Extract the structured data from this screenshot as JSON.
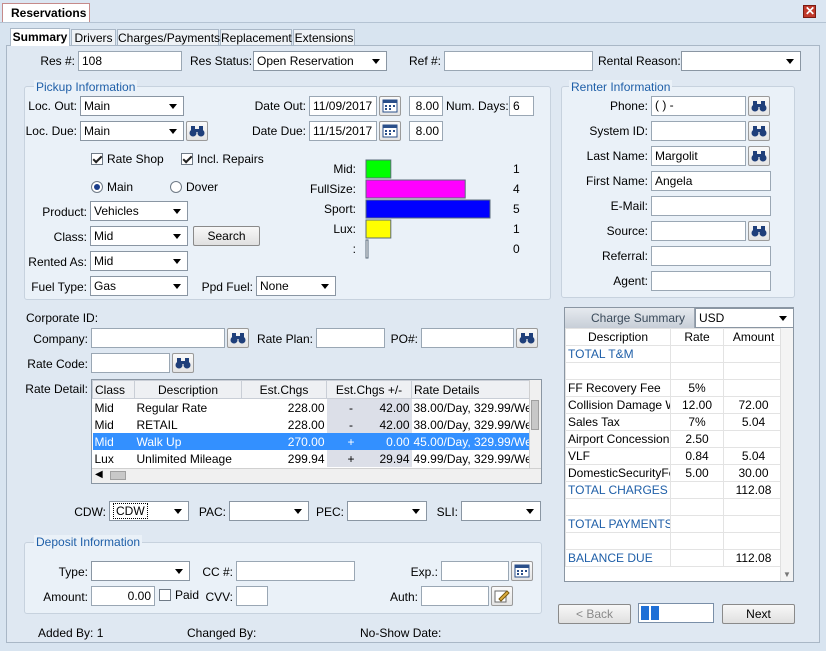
{
  "window": {
    "title": "Reservations"
  },
  "tabs": [
    "Summary",
    "Drivers",
    "Charges/Payments",
    "Replacement",
    "Extensions"
  ],
  "header": {
    "res_no_label": "Res #:",
    "res_no": "108",
    "res_status_label": "Res Status:",
    "res_status": "Open Reservation",
    "ref_label": "Ref #:",
    "ref": "",
    "rental_reason_label": "Rental Reason:",
    "rental_reason": ""
  },
  "pickup": {
    "title": "Pickup Information",
    "loc_out_label": "Loc. Out:",
    "loc_out": "Main",
    "loc_due_label": "Loc. Due:",
    "loc_due": "Main",
    "date_out_label": "Date Out:",
    "date_out": "11/09/2017",
    "time_out": "8.00",
    "num_days_label": "Num. Days:",
    "num_days": "6",
    "date_due_label": "Date Due:",
    "date_due": "11/15/2017",
    "time_due": "8.00",
    "rate_shop_label": "Rate Shop",
    "rate_shop": true,
    "incl_repairs_label": "Incl. Repairs",
    "incl_repairs": true,
    "radio_main": "Main",
    "radio_dover": "Dover",
    "product_label": "Product:",
    "product": "Vehicles",
    "class_label": "Class:",
    "class": "Mid",
    "search_label": "Search",
    "rented_as_label": "Rented As:",
    "rented_as": "Mid",
    "fuel_type_label": "Fuel Type:",
    "fuel_type": "Gas",
    "ppd_fuel_label": "Ppd Fuel:",
    "ppd_fuel": "None"
  },
  "chart_data": {
    "type": "bar",
    "orientation": "horizontal",
    "categories": [
      "Mid:",
      "FullSize:",
      "Sport:",
      "Lux:",
      ":"
    ],
    "values": [
      1,
      4,
      5,
      1,
      0
    ],
    "colors": [
      "#00ff00",
      "#ff00ff",
      "#0000ff",
      "#ffff00",
      "#ffffff"
    ],
    "xlim": [
      0,
      5
    ]
  },
  "corporate": {
    "corporate_id_label": "Corporate ID:",
    "company_label": "Company:",
    "company": "",
    "rate_plan_label": "Rate Plan:",
    "rate_plan": "",
    "po_label": "PO#:",
    "po": "",
    "rate_code_label": "Rate Code:",
    "rate_code": "",
    "rate_detail_label": "Rate Detail:"
  },
  "rate_table": {
    "headers": [
      "Class",
      "Description",
      "Est.Chgs",
      "Est.Chgs +/-",
      "Rate Details"
    ],
    "rows": [
      {
        "class": "Mid",
        "description": "Regular Rate",
        "est": "228.00",
        "sign": "-",
        "diff": "42.00",
        "details": "38.00/Day, 329.99/We"
      },
      {
        "class": "Mid",
        "description": "RETAIL",
        "est": "228.00",
        "sign": "-",
        "diff": "42.00",
        "details": "38.00/Day, 329.99/We"
      },
      {
        "class": "Mid",
        "description": "Walk Up",
        "est": "270.00",
        "sign": "+",
        "diff": "0.00",
        "details": "45.00/Day, 329.99/We"
      },
      {
        "class": "Lux",
        "description": "Unlimited Mileage",
        "est": "299.94",
        "sign": "+",
        "diff": "29.94",
        "details": "49.99/Day, 329.99/We"
      }
    ],
    "selected_row": 2
  },
  "coverage": {
    "cdw_label": "CDW:",
    "cdw": "CDW",
    "pac_label": "PAC:",
    "pac": "",
    "pec_label": "PEC:",
    "pec": "",
    "sli_label": "SLI:",
    "sli": ""
  },
  "deposit": {
    "title": "Deposit Information",
    "type_label": "Type:",
    "type": "",
    "cc_label": "CC #:",
    "cc": "",
    "exp_label": "Exp.:",
    "exp": "",
    "amount_label": "Amount:",
    "amount": "0.00",
    "paid_label": "Paid",
    "paid": false,
    "cvv_label": "CVV:",
    "cvv": "",
    "auth_label": "Auth:",
    "auth": ""
  },
  "renter": {
    "title": "Renter Information",
    "phone_label": "Phone:",
    "phone": "(   )    -",
    "system_id_label": "System ID:",
    "system_id": "",
    "last_name_label": "Last Name:",
    "last_name": "Margolit",
    "first_name_label": "First Name:",
    "first_name": "Angela",
    "email_label": "E-Mail:",
    "email": "",
    "source_label": "Source:",
    "source": "",
    "referral_label": "Referral:",
    "referral": "",
    "agent_label": "Agent:",
    "agent": ""
  },
  "charge_summary": {
    "title": "Charge Summary",
    "currency": "USD",
    "headers": [
      "Description",
      "Rate",
      "Amount"
    ],
    "rows": [
      {
        "desc": "TOTAL T&M",
        "rate": "",
        "amount": "",
        "total": true
      },
      {
        "desc": "",
        "rate": "",
        "amount": "",
        "total": false
      },
      {
        "desc": "FF Recovery Fee",
        "rate": "5%",
        "amount": "",
        "total": false
      },
      {
        "desc": "Collision Damage Wa",
        "rate": "12.00",
        "amount": "72.00",
        "total": false
      },
      {
        "desc": "Sales Tax",
        "rate": "7%",
        "amount": "5.04",
        "total": false
      },
      {
        "desc": "Airport Concession",
        "rate": "2.50",
        "amount": "",
        "total": false
      },
      {
        "desc": "VLF",
        "rate": "0.84",
        "amount": "5.04",
        "total": false
      },
      {
        "desc": "DomesticSecurityFee",
        "rate": "5.00",
        "amount": "30.00",
        "total": false
      },
      {
        "desc": "TOTAL CHARGES",
        "rate": "",
        "amount": "112.08",
        "total": true
      },
      {
        "desc": "",
        "rate": "",
        "amount": "",
        "total": false
      },
      {
        "desc": "TOTAL PAYMENTS",
        "rate": "",
        "amount": "",
        "total": true
      },
      {
        "desc": "",
        "rate": "",
        "amount": "",
        "total": false
      },
      {
        "desc": "BALANCE DUE",
        "rate": "",
        "amount": "112.08",
        "total": true
      }
    ]
  },
  "nav": {
    "back_label": "< Back",
    "next_label": "Next"
  },
  "footer": {
    "added_by": "Added By: 1",
    "changed_by": "Changed By:",
    "no_show": "No-Show Date:"
  },
  "icons": {
    "search": "binoculars-icon",
    "calendar": "calendar-icon",
    "close": "close-icon",
    "edit": "edit-icon"
  }
}
